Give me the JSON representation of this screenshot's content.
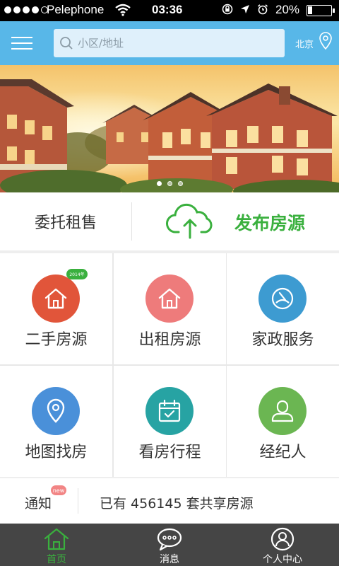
{
  "status_bar": {
    "carrier": "Pelephone",
    "time": "03:36",
    "battery_percent": "20%",
    "battery_level": 0.2
  },
  "header": {
    "search_placeholder": "小区/地址",
    "city": "北京"
  },
  "banner": {
    "slide_count": 3,
    "active_index": 0
  },
  "publish_row": {
    "commission_label": "委托租售",
    "publish_label": "发布房源"
  },
  "grid": {
    "items": [
      {
        "label": "二手房源",
        "color": "#e1553a",
        "icon": "house-icon",
        "badge": "2014年"
      },
      {
        "label": "出租房源",
        "color": "#ee7b7b",
        "icon": "house-icon"
      },
      {
        "label": "家政服务",
        "color": "#3d9bd1",
        "icon": "cleaning-icon"
      },
      {
        "label": "地图找房",
        "color": "#4a90d9",
        "icon": "map-pin-icon"
      },
      {
        "label": "看房行程",
        "color": "#27a3a3",
        "icon": "calendar-icon"
      },
      {
        "label": "经纪人",
        "color": "#6bb652",
        "icon": "person-icon"
      }
    ]
  },
  "notice": {
    "label": "通知",
    "badge": "new",
    "text": "已有 456145 套共享房源"
  },
  "tab_bar": {
    "tabs": [
      {
        "label": "首页",
        "icon": "home-icon",
        "active": true
      },
      {
        "label": "消息",
        "icon": "message-icon",
        "active": false
      },
      {
        "label": "个人中心",
        "icon": "profile-icon",
        "active": false
      }
    ]
  }
}
